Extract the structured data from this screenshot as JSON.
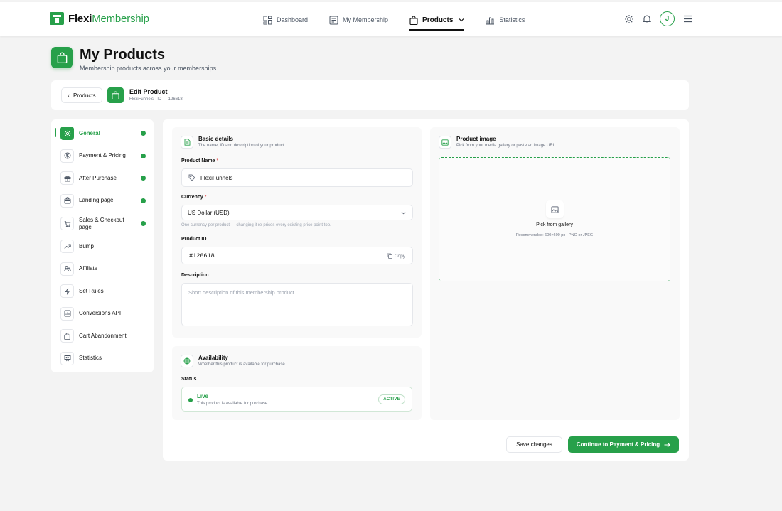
{
  "app": {
    "logo_primary": "Flexi",
    "logo_secondary": "Membership",
    "accent_color": "#27a04a"
  },
  "nav": {
    "items": [
      {
        "label": "Dashboard",
        "icon": "dashboard-icon"
      },
      {
        "label": "My Membership",
        "icon": "membership-icon"
      },
      {
        "label": "Products",
        "icon": "bag-icon",
        "active": true
      },
      {
        "label": "Statistics",
        "icon": "bar-chart-icon"
      }
    ],
    "avatar_initial": "J"
  },
  "header": {
    "title": "My Products",
    "subtitle": "Membership products across your memberships."
  },
  "editbar": {
    "back_label": "Products",
    "title": "Edit Product",
    "meta": "FlexiFunnels · ID — 126618"
  },
  "sidebar": {
    "items": [
      {
        "label": "General",
        "icon": "gear-icon",
        "done": true,
        "active": true
      },
      {
        "label": "Payment & Pricing",
        "icon": "dollar-icon",
        "done": true
      },
      {
        "label": "After Purchase",
        "icon": "gift-icon",
        "done": true
      },
      {
        "label": "Landing page",
        "icon": "landing-icon",
        "done": true
      },
      {
        "label": "Sales & Checkout page",
        "icon": "cart-icon",
        "done": true
      },
      {
        "label": "Bump",
        "icon": "trend-icon",
        "done": false
      },
      {
        "label": "Affiliate",
        "icon": "users-icon",
        "done": false
      },
      {
        "label": "Set Rules",
        "icon": "bolt-icon",
        "done": false
      },
      {
        "label": "Conversions API",
        "icon": "chart-icon",
        "done": false
      },
      {
        "label": "Cart Abandonment",
        "icon": "bag-icon",
        "done": false
      },
      {
        "label": "Statistics",
        "icon": "stats-icon",
        "done": false
      }
    ]
  },
  "basic": {
    "title": "Basic details",
    "subtitle": "The name, ID and description of your product.",
    "name_label": "Product Name",
    "name_required": "*",
    "name_value": "FlexiFunnels",
    "currency_label": "Currency",
    "currency_required": "*",
    "currency_value": "US Dollar (USD)",
    "currency_hint": "One currency per product — changing it re-prices every existing price point too.",
    "id_label": "Product ID",
    "id_value": "#126618",
    "copy_label": "Copy",
    "desc_label": "Description",
    "desc_placeholder": "Short description of this membership product..."
  },
  "image": {
    "title": "Product image",
    "subtitle": "Pick from your media gallery or paste an image URL.",
    "drop_title": "Pick from gallery",
    "drop_sub": "Recommended: 600×600 px · PNG or JPEG"
  },
  "availability": {
    "title": "Availability",
    "subtitle": "Whether this product is available for purchase.",
    "status_label": "Status",
    "status_title": "Live",
    "status_sub": "This product is available for purchase.",
    "status_badge": "ACTIVE"
  },
  "footer": {
    "save_label": "Save changes",
    "next_label": "Continue to Payment & Pricing"
  }
}
